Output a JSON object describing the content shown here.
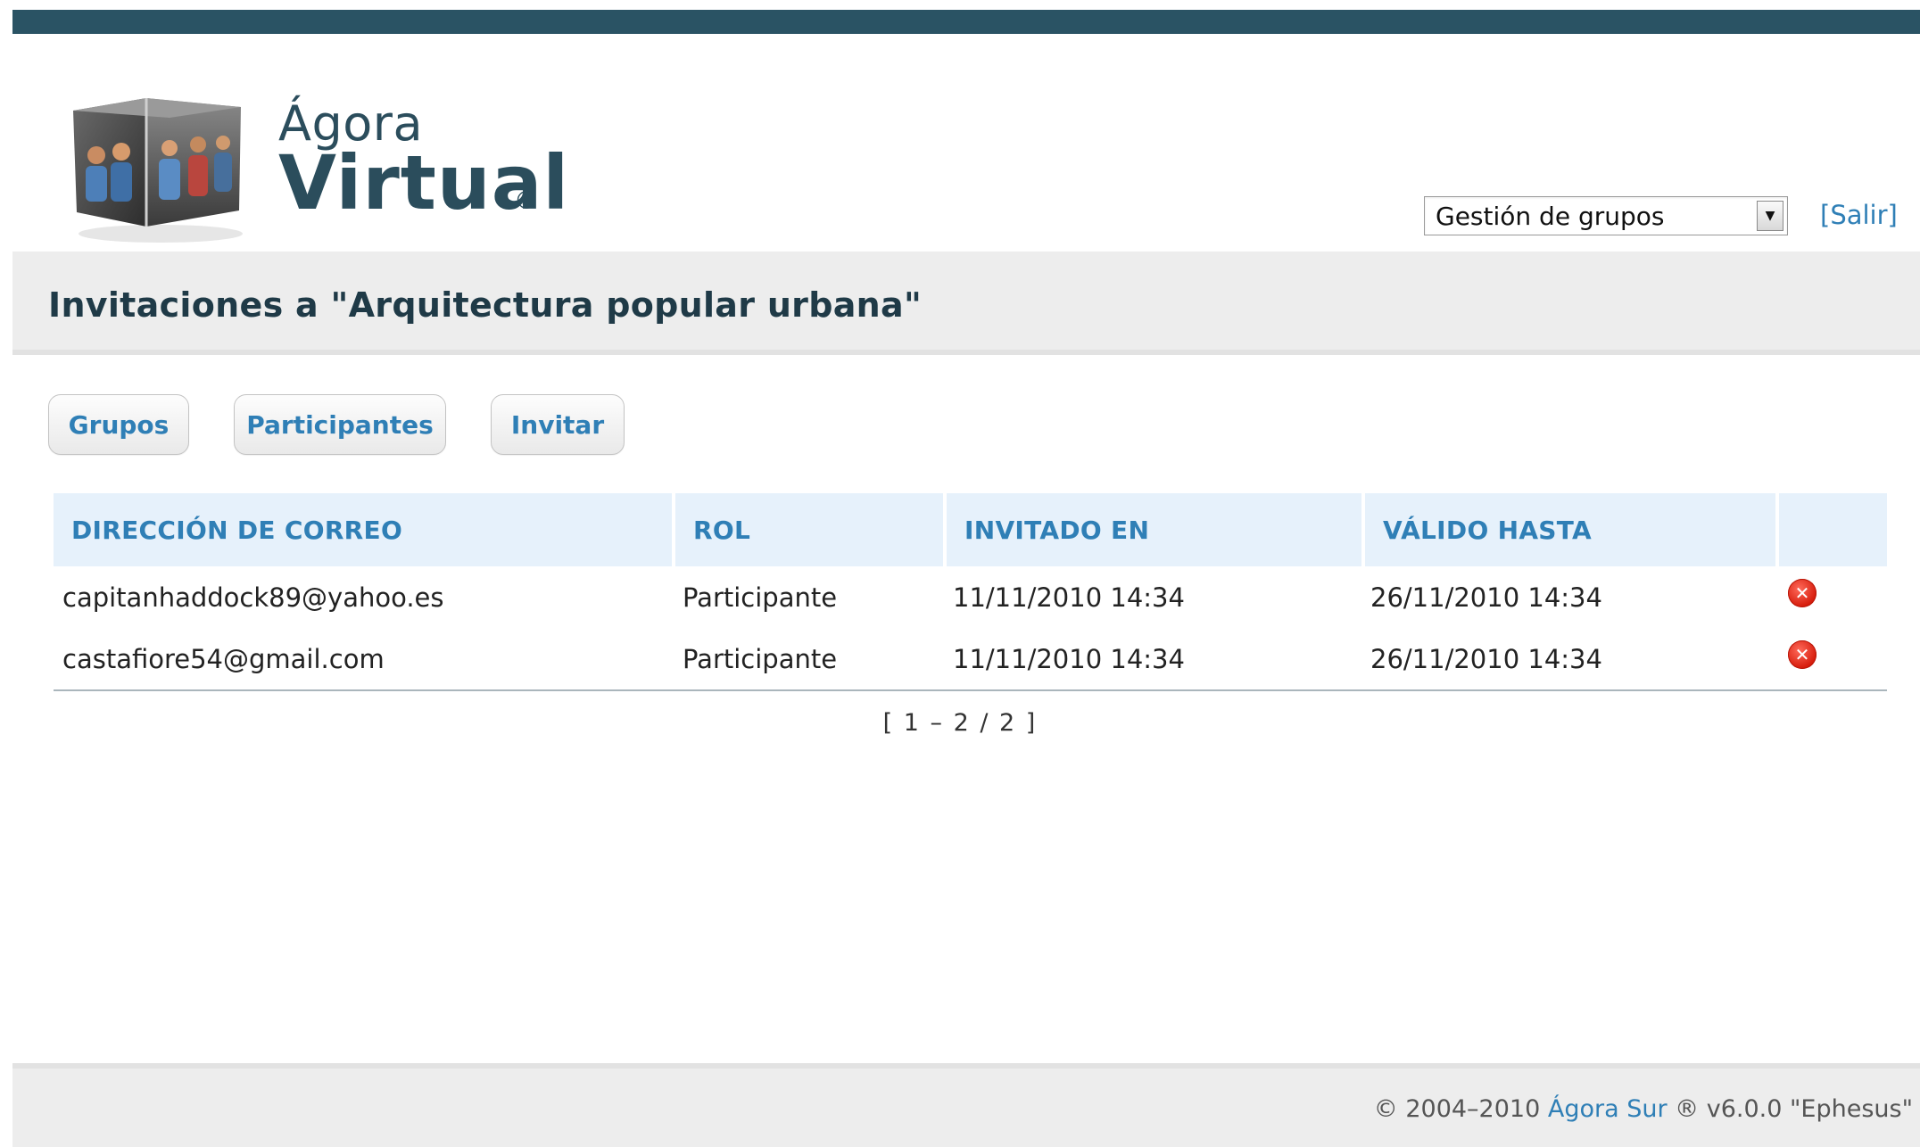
{
  "brand": {
    "top": "Ágora",
    "main": "Virtual",
    "reg": "®"
  },
  "nav": {
    "select_value": "Gestión de grupos",
    "logout_label": "[Salir]"
  },
  "page": {
    "title": "Invitaciones a \"Arquitectura popular urbana\""
  },
  "actions": {
    "groups_label": "Grupos",
    "participants_label": "Participantes",
    "invite_label": "Invitar"
  },
  "table": {
    "headers": {
      "email": "DIRECCIÓN DE CORREO",
      "role": "ROL",
      "invited": "INVITADO EN",
      "valid": "VÁLIDO HASTA"
    },
    "rows": [
      {
        "email": "capitanhaddock89@yahoo.es",
        "role": "Participante",
        "invited": "11/11/2010 14:34",
        "valid": "26/11/2010 14:34"
      },
      {
        "email": "castafiore54@gmail.com",
        "role": "Participante",
        "invited": "11/11/2010 14:34",
        "valid": "26/11/2010 14:34"
      }
    ]
  },
  "pager": {
    "text": "[ 1 – 2 / 2 ]"
  },
  "footer": {
    "copyright": "© 2004–2010 ",
    "link": "Ágora Sur",
    "version": " ® v6.0.0 \"Ephesus\""
  },
  "colors": {
    "topbar": "#2a5364",
    "link": "#2f7fb6",
    "header_bg": "#e6f1fb",
    "delete": "#d61c0c"
  },
  "icons": {
    "delete": "delete-icon",
    "dropdown": "chevron-down-icon"
  }
}
